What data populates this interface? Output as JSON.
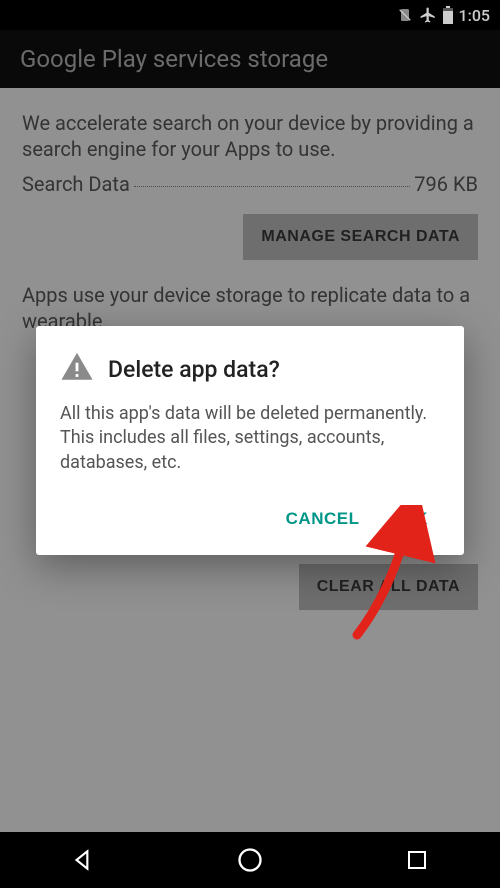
{
  "colors": {
    "accent": "#009688",
    "arrow": "#e2231a"
  },
  "status_bar": {
    "time": "1:05"
  },
  "app_bar": {
    "title": "Google Play services storage"
  },
  "section1": {
    "desc": "We accelerate search on your device by providing a search engine for your Apps to use.",
    "row_label": "Search Data",
    "row_value": "796 KB",
    "button": "MANAGE SEARCH DATA"
  },
  "section2": {
    "desc": "Apps use your device storage to replicate data to a wearable."
  },
  "section3": {
    "button": "CLEAR ALL DATA"
  },
  "dialog": {
    "title": "Delete app data?",
    "body": "All this app's data will be deleted permanently. This includes all files, settings, accounts, databases, etc.",
    "cancel": "CANCEL",
    "ok": "OK"
  }
}
